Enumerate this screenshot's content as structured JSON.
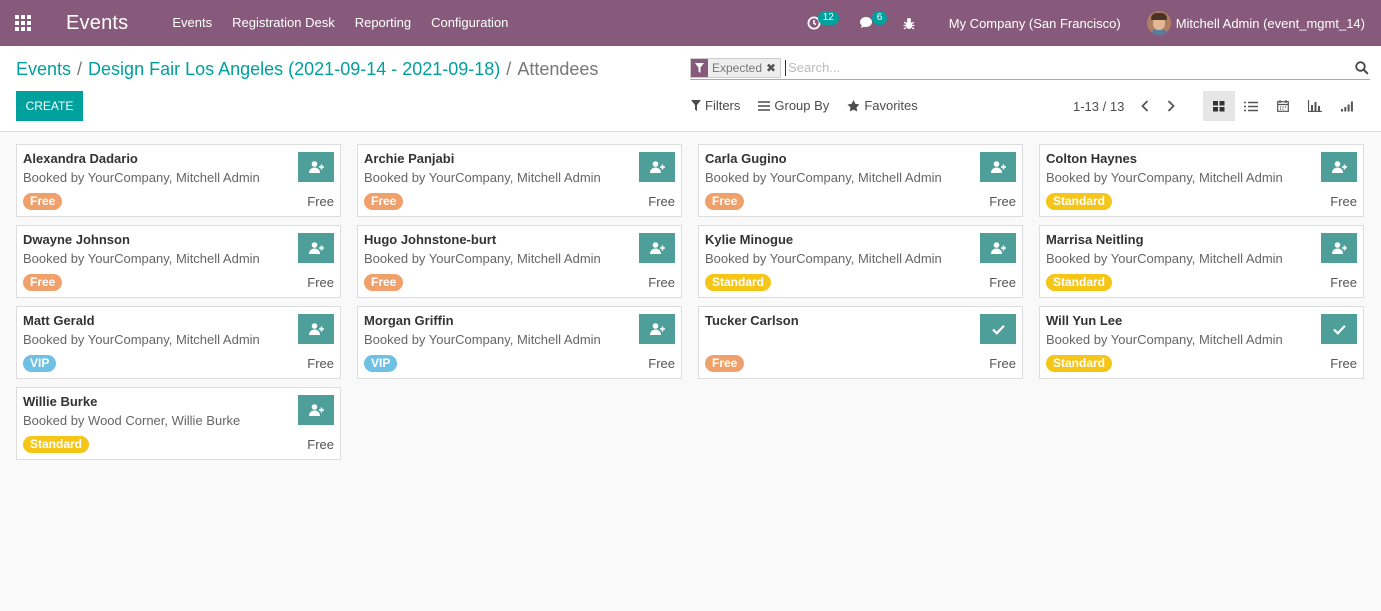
{
  "app": {
    "title": "Events",
    "menu": [
      "Events",
      "Registration Desk",
      "Reporting",
      "Configuration"
    ]
  },
  "systray": {
    "activity_count": "12",
    "message_count": "6",
    "company": "My Company (San Francisco)",
    "user": "Mitchell Admin (event_mgmt_14)"
  },
  "breadcrumb": {
    "root": "Events",
    "event": "Design Fair Los Angeles (2021-09-14 - 2021-09-18)",
    "current": "Attendees"
  },
  "create_label": "CREATE",
  "search": {
    "facet": "Expected",
    "remove_symbol": "✖",
    "placeholder": "Search..."
  },
  "filters": {
    "filters_label": "Filters",
    "groupby_label": "Group By",
    "favorites_label": "Favorites"
  },
  "pager": {
    "value": "1-13 / 13"
  },
  "colors": {
    "navbar": "#875a7b",
    "accent": "#00A09D",
    "action_button": "#4e9e9a",
    "free": "#f0a06b",
    "standard": "#f5c518",
    "vip": "#6ec1e4"
  },
  "attendees": [
    {
      "name": "Alexandra Dadario",
      "booked": "Booked by YourCompany, Mitchell Admin",
      "ticket": "Free",
      "ticket_type": "free",
      "price": "Free",
      "action": "add-user"
    },
    {
      "name": "Archie Panjabi",
      "booked": "Booked by YourCompany, Mitchell Admin",
      "ticket": "Free",
      "ticket_type": "free",
      "price": "Free",
      "action": "add-user"
    },
    {
      "name": "Carla Gugino",
      "booked": "Booked by YourCompany, Mitchell Admin",
      "ticket": "Free",
      "ticket_type": "free",
      "price": "Free",
      "action": "add-user"
    },
    {
      "name": "Colton Haynes",
      "booked": "Booked by YourCompany, Mitchell Admin",
      "ticket": "Standard",
      "ticket_type": "standard",
      "price": "Free",
      "action": "add-user"
    },
    {
      "name": "Dwayne Johnson",
      "booked": "Booked by YourCompany, Mitchell Admin",
      "ticket": "Free",
      "ticket_type": "free",
      "price": "Free",
      "action": "add-user"
    },
    {
      "name": "Hugo Johnstone-burt",
      "booked": "Booked by YourCompany, Mitchell Admin",
      "ticket": "Free",
      "ticket_type": "free",
      "price": "Free",
      "action": "add-user"
    },
    {
      "name": "Kylie Minogue",
      "booked": "Booked by YourCompany, Mitchell Admin",
      "ticket": "Standard",
      "ticket_type": "standard",
      "price": "Free",
      "action": "add-user"
    },
    {
      "name": "Marrisa Neitling",
      "booked": "Booked by YourCompany, Mitchell Admin",
      "ticket": "Standard",
      "ticket_type": "standard",
      "price": "Free",
      "action": "add-user"
    },
    {
      "name": "Matt Gerald",
      "booked": "Booked by YourCompany, Mitchell Admin",
      "ticket": "VIP",
      "ticket_type": "vip",
      "price": "Free",
      "action": "add-user"
    },
    {
      "name": "Morgan Griffin",
      "booked": "Booked by YourCompany, Mitchell Admin",
      "ticket": "VIP",
      "ticket_type": "vip",
      "price": "Free",
      "action": "add-user"
    },
    {
      "name": "Tucker Carlson",
      "booked": "",
      "ticket": "Free",
      "ticket_type": "free",
      "price": "Free",
      "action": "check"
    },
    {
      "name": "Will Yun Lee",
      "booked": "Booked by YourCompany, Mitchell Admin",
      "ticket": "Standard",
      "ticket_type": "standard",
      "price": "Free",
      "action": "check"
    },
    {
      "name": "Willie Burke",
      "booked": "Booked by Wood Corner, Willie Burke",
      "ticket": "Standard",
      "ticket_type": "standard",
      "price": "Free",
      "action": "add-user"
    }
  ]
}
